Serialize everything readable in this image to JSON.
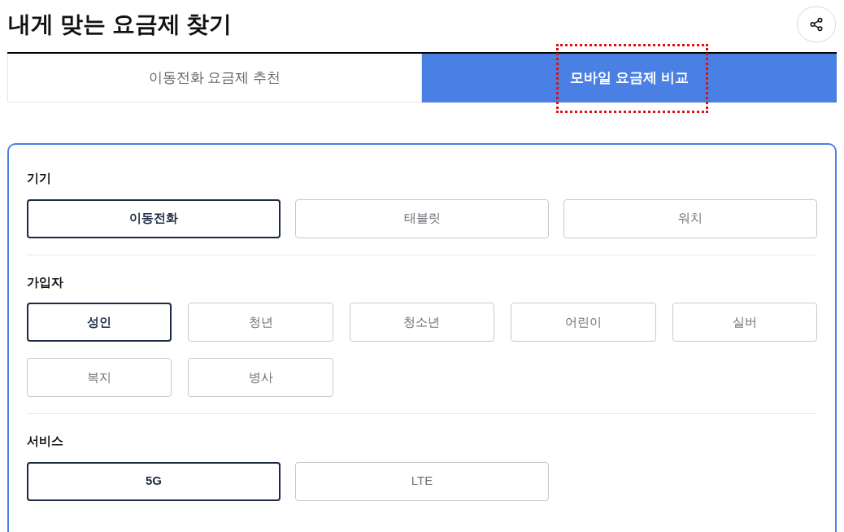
{
  "title": "내게 맞는 요금제 찾기",
  "tabs": [
    {
      "label": "이동전화 요금제 추천",
      "selected": false,
      "highlighted": false
    },
    {
      "label": "모바일 요금제 비교",
      "selected": true,
      "highlighted": true
    }
  ],
  "sections": [
    {
      "label": "기기",
      "options": [
        {
          "label": "이동전화",
          "selected": true
        },
        {
          "label": "태블릿",
          "selected": false
        },
        {
          "label": "워치",
          "selected": false
        }
      ]
    },
    {
      "label": "가입자",
      "options": [
        {
          "label": "성인",
          "selected": true
        },
        {
          "label": "청년",
          "selected": false
        },
        {
          "label": "청소년",
          "selected": false
        },
        {
          "label": "어린이",
          "selected": false
        },
        {
          "label": "실버",
          "selected": false
        },
        {
          "label": "복지",
          "selected": false
        },
        {
          "label": "병사",
          "selected": false
        }
      ]
    },
    {
      "label": "서비스",
      "options": [
        {
          "label": "5G",
          "selected": true
        },
        {
          "label": "LTE",
          "selected": false
        }
      ]
    }
  ]
}
